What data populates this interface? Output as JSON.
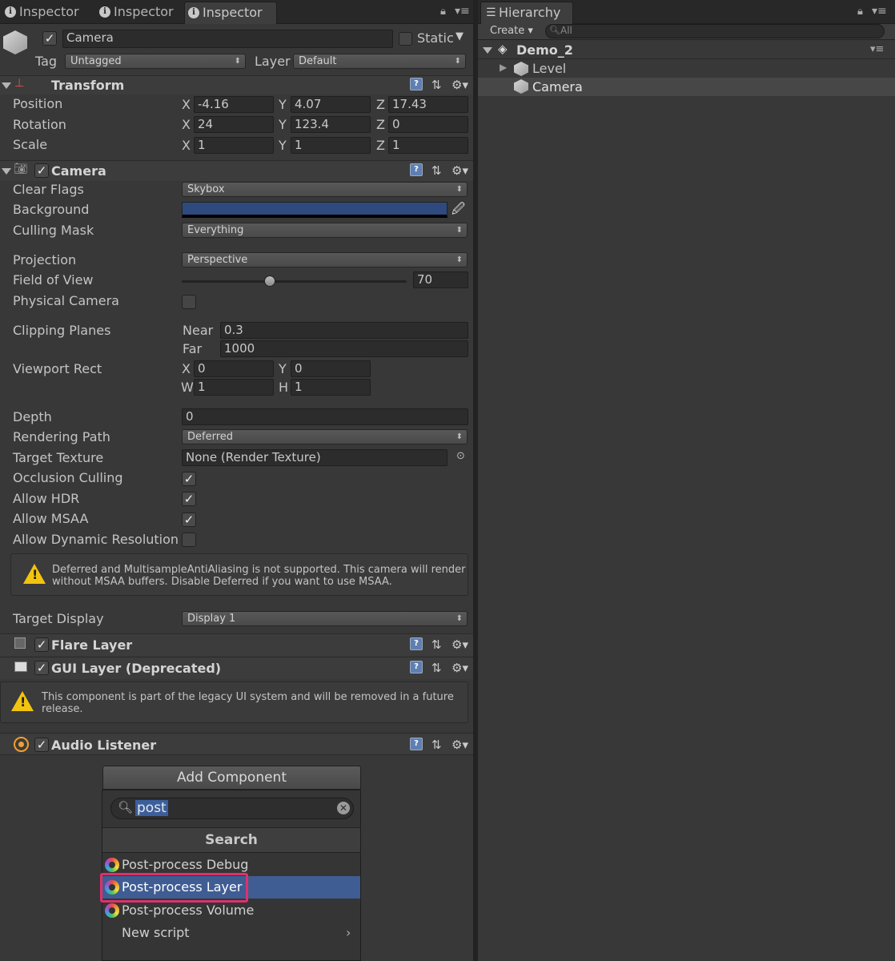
{
  "inspector": {
    "tabs": [
      "Inspector",
      "Inspector",
      "Inspector"
    ],
    "object": {
      "name": "Camera",
      "static_label": "Static",
      "tag_label": "Tag",
      "tag": "Untagged",
      "layer_label": "Layer",
      "layer": "Default"
    },
    "transform": {
      "title": "Transform",
      "position": {
        "label": "Position",
        "x": "-4.16",
        "y": "4.07",
        "z": "17.43"
      },
      "rotation": {
        "label": "Rotation",
        "x": "24",
        "y": "123.4",
        "z": "0"
      },
      "scale": {
        "label": "Scale",
        "x": "1",
        "y": "1",
        "z": "1"
      },
      "axes": [
        "X",
        "Y",
        "Z"
      ]
    },
    "camera": {
      "title": "Camera",
      "clear_flags": {
        "label": "Clear Flags",
        "value": "Skybox"
      },
      "background": {
        "label": "Background",
        "color": "#2f4a7e"
      },
      "culling_mask": {
        "label": "Culling Mask",
        "value": "Everything"
      },
      "projection": {
        "label": "Projection",
        "value": "Perspective"
      },
      "fov": {
        "label": "Field of View",
        "value": "70",
        "slider_fraction": 0.39
      },
      "physical": {
        "label": "Physical Camera"
      },
      "clipping": {
        "label": "Clipping Planes",
        "near_label": "Near",
        "near": "0.3",
        "far_label": "Far",
        "far": "1000"
      },
      "viewport": {
        "label": "Viewport Rect",
        "x": "0",
        "y": "0",
        "w": "1",
        "h": "1",
        "x_label": "X",
        "y_label": "Y",
        "w_label": "W",
        "h_label": "H"
      },
      "depth": {
        "label": "Depth",
        "value": "0"
      },
      "rendering_path": {
        "label": "Rendering Path",
        "value": "Deferred"
      },
      "target_texture": {
        "label": "Target Texture",
        "value": "None (Render Texture)"
      },
      "occlusion": {
        "label": "Occlusion Culling"
      },
      "hdr": {
        "label": "Allow HDR"
      },
      "msaa": {
        "label": "Allow MSAA"
      },
      "dynres": {
        "label": "Allow Dynamic Resolution"
      },
      "warning_line1": "Deferred and MultisampleAntiAliasing is not supported. This camera will render",
      "warning_line2": "without MSAA buffers. Disable Deferred if you want to use MSAA.",
      "target_display": {
        "label": "Target Display",
        "value": "Display 1"
      }
    },
    "flare": {
      "title": "Flare Layer"
    },
    "gui": {
      "title": "GUI Layer (Deprecated)",
      "warning_line1": "This component is part of the legacy UI system and will be removed in a future",
      "warning_line2": "release."
    },
    "audio": {
      "title": "Audio Listener"
    },
    "add_component": {
      "button": "Add Component",
      "search_value": "post",
      "section": "Search",
      "items": [
        "Post-process Debug",
        "Post-process Layer",
        "Post-process Volume",
        "New script"
      ],
      "selected_index": 1,
      "highlight_color": "#e0306a"
    }
  },
  "hierarchy": {
    "tab": "Hierarchy",
    "create_label": "Create",
    "search_placeholder": "All",
    "scene": "Demo_2",
    "items": [
      "Level",
      "Camera"
    ]
  }
}
